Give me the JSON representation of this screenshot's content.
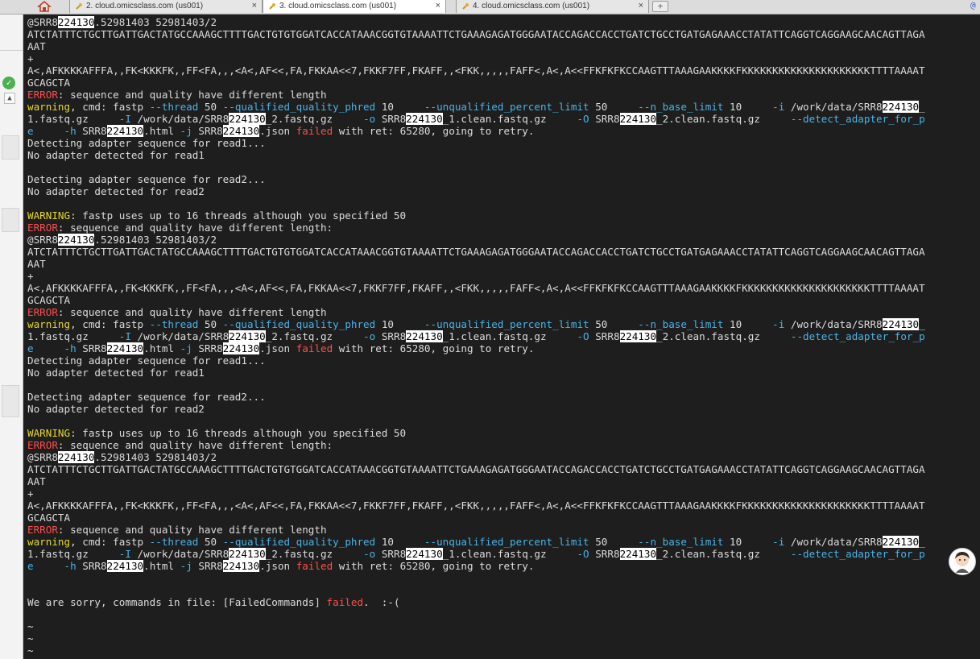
{
  "tabs": [
    {
      "label": "2. cloud.omicsclass.com (us001)",
      "close": "×"
    },
    {
      "label": "3. cloud.omicsclass.com (us001)",
      "close": "×"
    },
    {
      "label": "4. cloud.omicsclass.com (us001)",
      "close": "×"
    }
  ],
  "new_tab_label": "+",
  "corner_glyph": "@",
  "highlight": "224130",
  "block": {
    "header": "@SRR8{h}.52981403 52981403/2",
    "seq1": "ATCTATTTCTGCTTGATTGACTATGCCAAAGCTTTTGACTGTGTGGATCACCATAAACGGTGTAAAATTCTGAAAGAGATGGGAATACCAGACCACCTGATCTGCCTGATGAGAAACCTATATTCAGGTCAGGAAGCAACAGTTAGA",
    "seq2": "AAT",
    "plus": "+",
    "qual1": "A<,AFKKKKAFFFA,,FK<KKKFK,,FF<FA,,,<A<,AF<<,FA,FKKAA<<7,FKKF7FF,FKAFF,,<FKK,,,,,FAFF<,A<,A<<FFKFKFKCCAAGTTTAAAGAAKKKKFKKKKKKKKKKKKKKKKKKKKKTTTTAAAAT",
    "qual2": "GCAGCTA",
    "error_word": "ERROR",
    "error_length": ": sequence and quality have different length",
    "error_length_colon": ": sequence and quality have different length:",
    "warning_word": "warning",
    "cmd_prefix": ", cmd: fastp ",
    "opt_thread": "--thread",
    "val_thread": " 50 ",
    "opt_phred": "--qualified_quality_phred",
    "val_phred": " 10     ",
    "opt_unq": "--unqualified_percent_limit",
    "val_unq": " 50     ",
    "opt_nbase": "--n_base_limit",
    "val_nbase": " 10     ",
    "opt_i": "-i",
    "val_i_pre": " /work/data/SRR8",
    "val_i_post1": "_",
    "line2_a": "1.fastq.gz     ",
    "opt_I": "-I",
    "val_I_pre": " /work/data/SRR8",
    "val_I_post": "_2.fastq.gz     ",
    "opt_o": "-o",
    "val_o_pre": " SRR8",
    "val_o_post": "_1.clean.fastq.gz     ",
    "opt_O": "-O",
    "val_O_pre": " SRR8",
    "val_O_post": "_2.clean.fastq.gz     ",
    "opt_detect": "--detect_adapter_for_p",
    "line3_a": "e",
    "line3_gap": "     ",
    "opt_h": "-h",
    "val_h_pre": " SRR8",
    "val_h_post": ".html ",
    "opt_j": "-j",
    "val_j_pre": " SRR8",
    "val_j_post": ".json ",
    "failed_word": "failed",
    "retry": " with ret: 65280, going to retry.",
    "detect1": "Detecting adapter sequence for read1...",
    "noadapt1": "No adapter detected for read1",
    "detect2": "Detecting adapter sequence for read2...",
    "noadapt2": "No adapter detected for read2",
    "WARNING_word": "WARNING",
    "threads_msg": ": fastp uses up to 16 threads although you specified 50",
    "error_colon_word": "ERROR"
  },
  "final": {
    "pre": "We are sorry, commands in file: [FailedCommands] ",
    "failed": "failed",
    "post": ".  :-("
  },
  "tilde": "~",
  "colors": {
    "error": "#ff4d4d",
    "warning": "#e6d82b",
    "option": "#4ab3e6",
    "background": "#1e1e1e"
  }
}
